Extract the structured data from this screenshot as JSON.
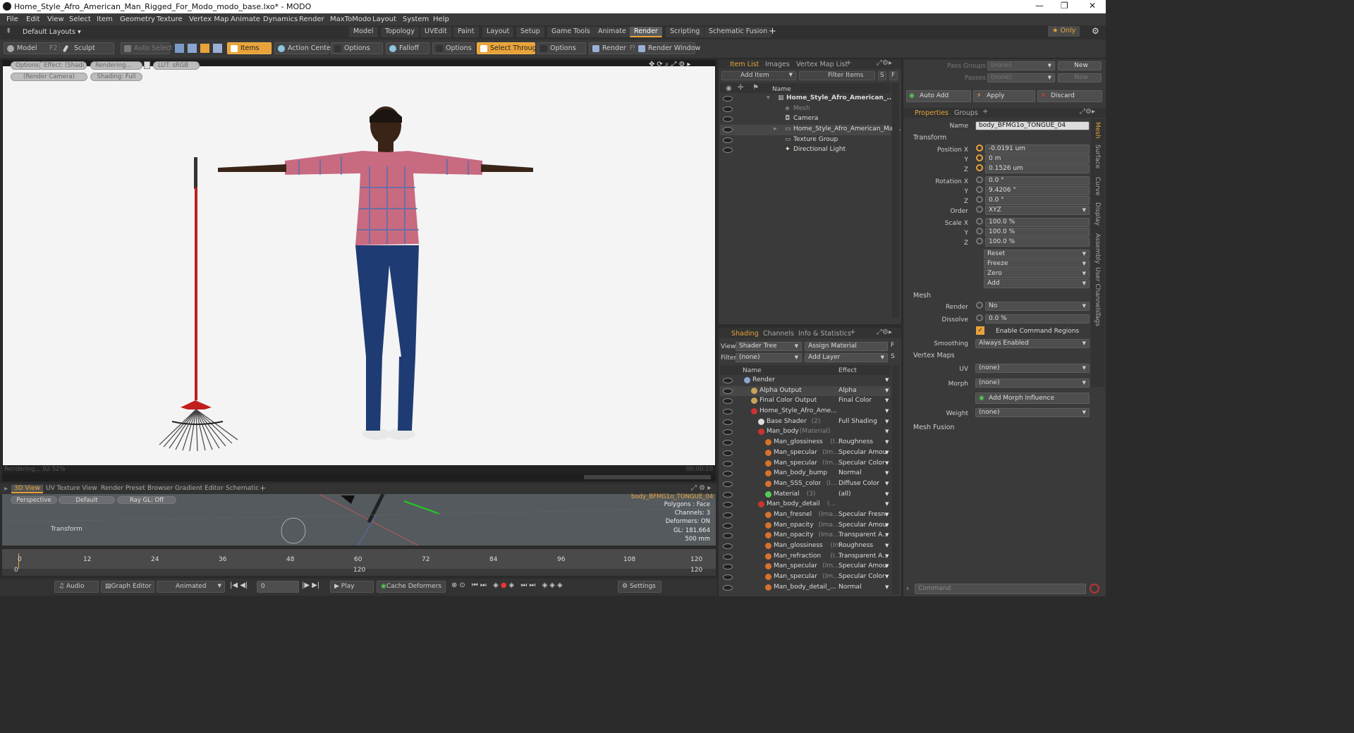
{
  "window": {
    "title": "Home_Style_Afro_American_Man_Rigged_For_Modo_modo_base.lxo* - MODO",
    "controls": [
      "—",
      "❐",
      "✕"
    ]
  },
  "menu": [
    "File",
    "Edit",
    "View",
    "Select",
    "Item",
    "Geometry",
    "Texture",
    "Vertex Map",
    "Animate",
    "Dynamics",
    "Render",
    "MaxToModo",
    "Layout",
    "System",
    "Help"
  ],
  "layout_menu": "Default Layouts ▾",
  "layout_tabs": [
    "Model",
    "Topology",
    "UVEdit",
    "Paint",
    "Layout",
    "Setup",
    "Game Tools",
    "Animate",
    "Render",
    "Scripting",
    "Schematic Fusion"
  ],
  "active_layout_tab": "Render",
  "only_label": "★ Only",
  "toolbar": {
    "model": "Model",
    "model_key": "F2",
    "sculpt": "Sculpt",
    "auto_select": "Auto Select",
    "items": "Items",
    "action_center": "Action Center",
    "options1": "Options",
    "falloff": "Falloff",
    "options2": "Options",
    "select_through": "Select Through",
    "options3": "Options",
    "render": "Render",
    "render_key": "F9",
    "render_window": "Render Window"
  },
  "viewport": {
    "btn_options": "Options",
    "btn_effect": "Effect: (Shadi",
    "btn_rendering": "Rendering...",
    "btn_lut": "LUT: sRGB",
    "btn_camera": "(Render Camera)",
    "btn_shading": "Shading: Full",
    "status_left": "Rendering... 92.52%",
    "status_right": "00:00:10"
  },
  "bottom_tabs": [
    "3D View",
    "UV Texture View",
    "Render Preset Browser",
    "Gradient Editor",
    "Schematic"
  ],
  "view3d": {
    "perspective": "Perspective",
    "default": "Default",
    "raygl": "Ray GL: Off",
    "transform": "Transform",
    "info_name": "body_BFMG1o_TONGUE_04",
    "info": [
      "Polygons : Face",
      "Channels: 3",
      "Deformers: ON",
      "GL: 181,664",
      "500 mm"
    ]
  },
  "timeline": {
    "ticks": [
      "0",
      "12",
      "24",
      "36",
      "48",
      "60",
      "72",
      "84",
      "96",
      "108",
      "120"
    ],
    "bottom_left": "0",
    "bottom_mid": "120",
    "bottom_right": "120"
  },
  "transport": {
    "audio": "Audio",
    "graph_editor": "Graph Editor",
    "animated": "Animated",
    "frame": "0",
    "play": "Play",
    "cache": "Cache Deformers",
    "settings": "Settings"
  },
  "item_list": {
    "tabs": [
      "Item List",
      "Images",
      "Vertex Map List"
    ],
    "add_item": "Add Item",
    "filter_items": "Filter Items",
    "s": "S",
    "f": "F",
    "col_name": "Name",
    "rows": [
      {
        "label": "Home_Style_Afro_American_...",
        "indent": 0
      },
      {
        "label": "Mesh",
        "indent": 1
      },
      {
        "label": "Camera",
        "indent": 1
      },
      {
        "label": "Home_Style_Afro_American_Ma ...",
        "indent": 1
      },
      {
        "label": "Texture Group",
        "indent": 1
      },
      {
        "label": "Directional Light",
        "indent": 1
      }
    ]
  },
  "shading": {
    "tabs": [
      "Shading",
      "Channels",
      "Info & Statistics"
    ],
    "view_label": "View",
    "view_value": "Shader Tree",
    "assign_material": "Assign Material",
    "filter_label": "Filter",
    "filter_value": "(none)",
    "add_layer": "Add Layer",
    "col_name": "Name",
    "col_effect": "Effect",
    "rows": [
      {
        "name": "Render",
        "sub": "",
        "effect": "",
        "indent": 0
      },
      {
        "name": "Alpha Output",
        "sub": "",
        "effect": "Alpha",
        "indent": 1
      },
      {
        "name": "Final Color Output",
        "sub": "",
        "effect": "Final Color",
        "indent": 1
      },
      {
        "name": "Home_Style_Afro_Ame...",
        "sub": "",
        "effect": "",
        "indent": 1
      },
      {
        "name": "Base Shader",
        "sub": "(2)",
        "effect": "Full Shading",
        "indent": 2
      },
      {
        "name": "Man_body",
        "sub": "(Material)",
        "effect": "",
        "indent": 2
      },
      {
        "name": "Man_glossiness",
        "sub": "(I...",
        "effect": "Roughness",
        "indent": 3
      },
      {
        "name": "Man_specular",
        "sub": "(Im...",
        "effect": "Specular Amou...",
        "indent": 3
      },
      {
        "name": "Man_specular",
        "sub": "(Im...",
        "effect": "Specular Color",
        "indent": 3
      },
      {
        "name": "Man_body_bump",
        "sub": "",
        "effect": "Normal",
        "indent": 3
      },
      {
        "name": "Man_SSS_color",
        "sub": "(I...",
        "effect": "Diffuse Color",
        "indent": 3
      },
      {
        "name": "Material",
        "sub": "(3)",
        "effect": "(all)",
        "indent": 3
      },
      {
        "name": "Man_body_detail",
        "sub": "(...",
        "effect": "",
        "indent": 2
      },
      {
        "name": "Man_fresnel",
        "sub": "(Ima...",
        "effect": "Specular Fresnel",
        "indent": 3
      },
      {
        "name": "Man_opacity",
        "sub": "(Ima...",
        "effect": "Specular Amou...",
        "indent": 3
      },
      {
        "name": "Man_opacity",
        "sub": "(Ima...",
        "effect": "Transparent A...",
        "indent": 3
      },
      {
        "name": "Man_glossiness",
        "sub": "(Im...",
        "effect": "Roughness",
        "indent": 3
      },
      {
        "name": "Man_refraction",
        "sub": "(I...",
        "effect": "Transparent A...",
        "indent": 3
      },
      {
        "name": "Man_specular",
        "sub": "(Im...",
        "effect": "Specular Amou...",
        "indent": 3
      },
      {
        "name": "Man_specular",
        "sub": "(Im...",
        "effect": "Specular Color",
        "indent": 3
      },
      {
        "name": "Man_body_detail_...",
        "sub": "",
        "effect": "Normal",
        "indent": 3
      }
    ]
  },
  "props": {
    "pass_groups_label": "Pass Groups",
    "pass_groups": "(none)",
    "passes_label": "Passes",
    "passes": "(none)",
    "new": "New",
    "auto_add": "Auto Add",
    "apply": "Apply",
    "discard": "Discard",
    "tabs": [
      "Properties",
      "Groups"
    ],
    "name_label": "Name",
    "name_value": "body_BFMG1o_TONGUE_04",
    "transform": "Transform",
    "position_label": "Position X",
    "pos_x": "-0.0191 um",
    "pos_y": "0 m",
    "pos_z": "0.1526 um",
    "rotation_label": "Rotation X",
    "rot_x": "0.0 °",
    "rot_y": "9.4206 °",
    "rot_z": "0.0 °",
    "order_label": "Order",
    "order": "XYZ",
    "scale_label": "Scale X",
    "scale_x": "100.0 %",
    "scale_y": "100.0 %",
    "scale_z": "100.0 %",
    "y": "Y",
    "z": "Z",
    "reset": "Reset",
    "freeze": "Freeze",
    "zero": "Zero",
    "add": "Add",
    "mesh": "Mesh",
    "render_label": "Render",
    "render": "No",
    "dissolve_label": "Dissolve",
    "dissolve": "0.0 %",
    "enable_cmd": "Enable Command Regions",
    "smoothing_label": "Smoothing",
    "smoothing": "Always Enabled",
    "vertex_maps": "Vertex Maps",
    "uv_label": "UV",
    "uv": "(none)",
    "morph_label": "Morph",
    "morph": "(none)",
    "add_morph": "Add Morph Influence",
    "weight_label": "Weight",
    "weight": "(none)",
    "mesh_fusion": "Mesh Fusion",
    "command": "Command",
    "side_tabs": [
      "Mesh",
      "Surface",
      "Curve",
      "Display",
      "Assembly",
      "User Channels",
      "Tags"
    ]
  },
  "colors": {
    "accent": "#e9a33a",
    "panel": "#3a3a3a",
    "viewport_bg": "#f4f4f4"
  }
}
